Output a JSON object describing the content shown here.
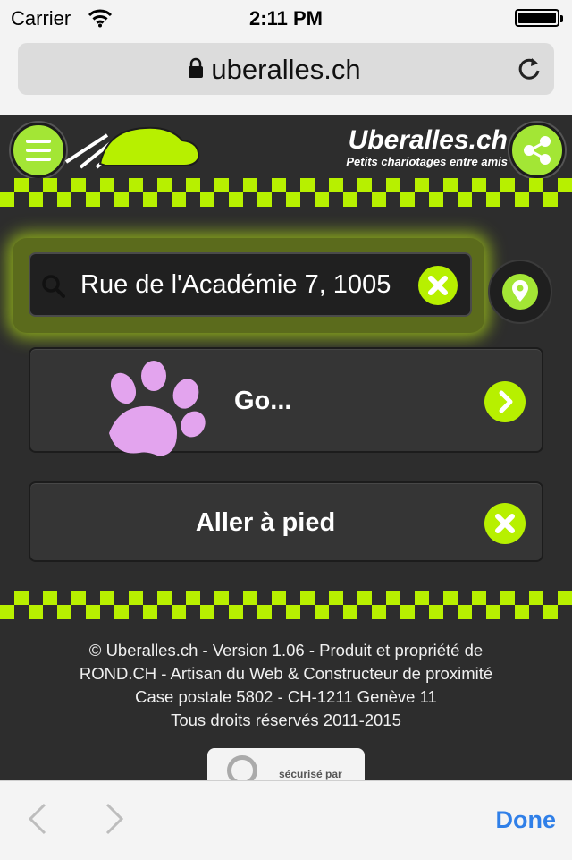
{
  "status_bar": {
    "carrier": "Carrier",
    "time": "2:11 PM"
  },
  "browser": {
    "url": "uberalles.ch",
    "done_label": "Done"
  },
  "header": {
    "brand_name": "Uberalles.ch",
    "tagline": "Petits chariotages entre amis"
  },
  "search": {
    "value": "Rue de l'Académie 7, 1005"
  },
  "actions": {
    "go_label": "Go...",
    "walk_label": "Aller à pied"
  },
  "footer": {
    "lines": [
      "© Uberalles.ch - Version 1.06 - Produit et propriété de",
      "ROND.CH - Artisan du Web & Constructeur de proximité",
      "Case postale 5802 - CH-1211 Genève 11",
      "Tous droits réservés 2011-2015"
    ],
    "badge_text": "sécurisé par"
  },
  "colors": {
    "accent": "#b7f000",
    "background": "#2d2d2d",
    "paw": "#e3a4ee",
    "link": "#2f7fe8"
  }
}
